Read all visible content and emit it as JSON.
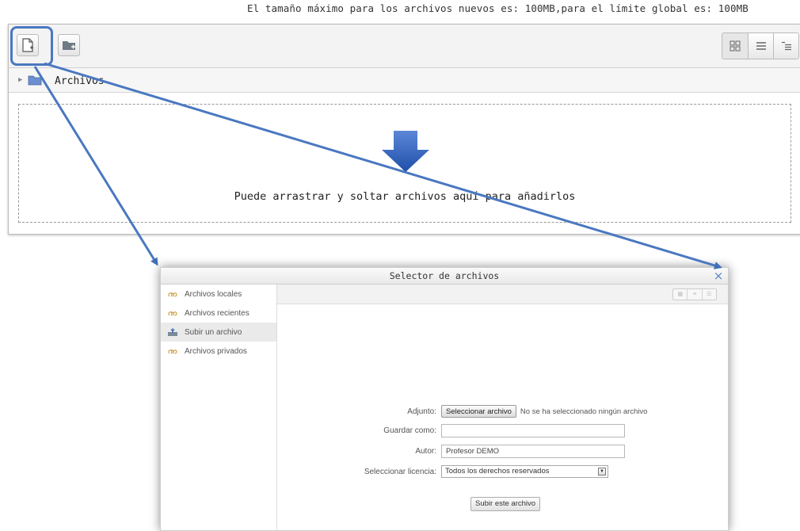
{
  "filemanager": {
    "max_size_text": "El tamaño máximo para los archivos nuevos es: 100MB,para el límite global es: 100MB",
    "toolbar": {
      "add_file_icon": "add-file-icon",
      "create_folder_icon": "create-folder-icon",
      "view_icons": [
        "icons-view",
        "list-view",
        "tree-view"
      ]
    },
    "path": {
      "folder_label": "Archivos"
    },
    "dropzone_text": "Puede arrastrar y soltar archivos aquí para añadirlos"
  },
  "dialog": {
    "title": "Selector de archivos",
    "close_glyph": "×",
    "repositories": [
      {
        "label": "Archivos locales",
        "icon": "moodle-icon"
      },
      {
        "label": "Archivos recientes",
        "icon": "moodle-icon"
      },
      {
        "label": "Subir un archivo",
        "icon": "upload-icon",
        "active": true
      },
      {
        "label": "Archivos privados",
        "icon": "moodle-icon"
      }
    ],
    "form": {
      "attachment_label": "Adjunto:",
      "choose_button": "Seleccionar archivo",
      "no_file_text": "No se ha seleccionado ningún archivo",
      "save_as_label": "Guardar como:",
      "save_as_value": "",
      "author_label": "Autor:",
      "author_value": "Profesor DEMO",
      "license_label": "Seleccionar licencia:",
      "license_value": "Todos los derechos reservados",
      "upload_button": "Subir este archivo"
    }
  },
  "colors": {
    "annotation": "#4a78c0",
    "accent_arrow": "#2f5faf"
  }
}
